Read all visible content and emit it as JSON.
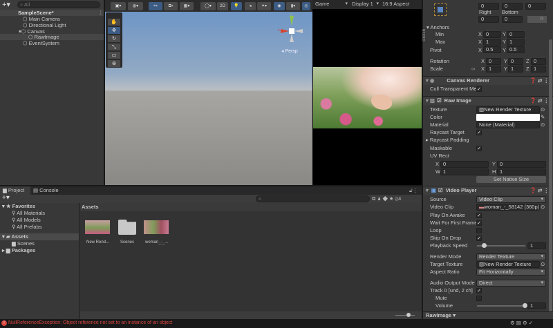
{
  "hierarchy": {
    "search_placeholder": "All",
    "scene": "SampleScene*",
    "items": [
      "Main Camera",
      "Directional Light",
      "Canvas",
      "RawImage",
      "EventSystem"
    ]
  },
  "scene_view": {
    "toolbar_2d": "2D",
    "persp_label": "Persp",
    "gizmo_x": "x",
    "gizmo_y": "y"
  },
  "game_view": {
    "tab": "Game",
    "display": "Display 1",
    "aspect": "16:9 Aspect"
  },
  "inspector": {
    "rect": {
      "stretch_label": "stretch",
      "top_values": [
        "0",
        "0",
        "0"
      ],
      "right_label": "Right",
      "bottom_label": "Bottom",
      "right_value": "0",
      "bottom_value": "0",
      "r_button": "R",
      "anchors": "Anchors",
      "min": "Min",
      "max": "Max",
      "min_x": "0",
      "min_y": "0",
      "max_x": "1",
      "max_y": "1",
      "pivot": "Pivot",
      "pivot_x": "0.5",
      "pivot_y": "0.5",
      "rotation": "Rotation",
      "rot": [
        "0",
        "0",
        "0"
      ],
      "scale": "Scale",
      "scl": [
        "1",
        "1",
        "1"
      ],
      "x": "X",
      "y": "Y",
      "z": "Z"
    },
    "canvas_renderer": {
      "title": "Canvas Renderer",
      "cull": "Cull Transparent Mes"
    },
    "raw_image": {
      "title": "Raw Image",
      "texture_label": "Texture",
      "texture": "New Render Texture",
      "color_label": "Color",
      "material_label": "Material",
      "material": "None (Material)",
      "raycast_target": "Raycast Target",
      "raycast_padding": "Raycast Padding",
      "maskable": "Maskable",
      "uv_rect": "UV Rect",
      "uv": {
        "x": "0",
        "y": "0",
        "w": "1",
        "h": "1"
      },
      "w": "W",
      "h": "H",
      "native_size": "Set Native Size"
    },
    "video_player": {
      "title": "Video Player",
      "source_label": "Source",
      "source": "Video Clip",
      "clip_label": "Video Clip",
      "clip": "woman_-_58142 (360p)",
      "play_on_awake": "Play On Awake",
      "wait_first": "Wait For First Frame",
      "loop": "Loop",
      "skip_on_drop": "Skip On Drop",
      "playback_speed": "Playback Speed",
      "speed_value": "1",
      "render_mode_label": "Render Mode",
      "render_mode": "Render Texture",
      "target_label": "Target Texture",
      "target": "New Render Texture",
      "aspect_label": "Aspect Ratio",
      "aspect": "Fit Horizontally",
      "audio_label": "Audio Output Mode",
      "audio": "Direct",
      "track": "Track 0 [und, 2 ch]",
      "mute": "Mute",
      "volume": "Volume",
      "volume_value": "1",
      "speed_fraction": 0.1,
      "volume_fraction": 1.0
    },
    "footer": "RawImage"
  },
  "project": {
    "tabs": [
      "Project",
      "Console"
    ],
    "favorites": "Favorites",
    "fav_items": [
      "All Materials",
      "All Models",
      "All Prefabs"
    ],
    "assets": "Assets",
    "scenes": "Scenes",
    "packages": "Packages",
    "breadcrumb": "Assets",
    "asset_items": [
      "New Rend...",
      "Scenes",
      "woman_-_..."
    ],
    "hidden_count": "4"
  },
  "status": {
    "error": "NullReferenceException: Object reference not set to an instance of an object",
    "error_color": "#d9463f"
  }
}
